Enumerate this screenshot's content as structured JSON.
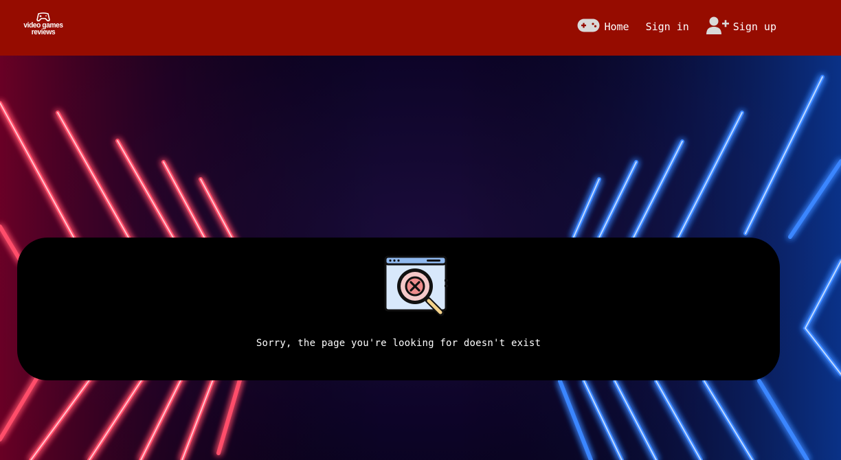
{
  "header": {
    "logo_line1": "video games",
    "logo_line2": "reviews",
    "nav": {
      "home_label": "Home",
      "signin_label": "Sign in",
      "signup_label": "Sign up"
    },
    "icons": {
      "logo": "gamepad-logo-icon",
      "home": "gamepad-icon",
      "signup": "user-plus-icon"
    }
  },
  "error": {
    "illustration": "page-not-found-icon",
    "message": "Sorry, the page you're looking for doesn't exist"
  },
  "colors": {
    "header_bg": "#960c00",
    "card_bg": "#000000",
    "neon_red": "#ff2b4a",
    "neon_blue": "#2f7bff",
    "scene_bg": "#0a0320"
  }
}
